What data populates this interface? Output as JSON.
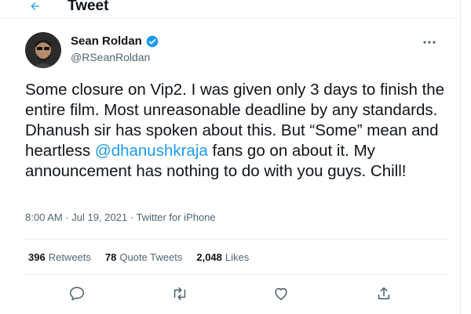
{
  "header": {
    "title": "Tweet",
    "back_icon": "arrow-left-icon"
  },
  "author": {
    "display_name": "Sean Roldan",
    "handle": "@RSeanRoldan",
    "verified": true
  },
  "tweet": {
    "text_before_mention": "Some closure on Vip2. I was given only 3 days to finish the entire film. Most unreasonable deadline by any standards. Dhanush sir has spoken about this. But “Some” mean and heartless ",
    "mention": "@dhanushkraja",
    "text_after_mention": " fans go on about it. My announcement has nothing to do with you guys. Chill!"
  },
  "meta": {
    "time": "8:00 AM",
    "separator_1": "·",
    "date": "Jul 19, 2021",
    "separator_2": "·",
    "source": "Twitter for iPhone"
  },
  "stats": {
    "retweets_count": "396",
    "retweets_label": "Retweets",
    "quotes_count": "78",
    "quotes_label": "Quote Tweets",
    "likes_count": "2,048",
    "likes_label": "Likes"
  },
  "actions": [
    "reply-icon",
    "retweet-icon",
    "like-icon",
    "share-icon"
  ],
  "colors": {
    "accent": "#1d9bf0",
    "text": "#0f1419",
    "muted": "#536471"
  }
}
